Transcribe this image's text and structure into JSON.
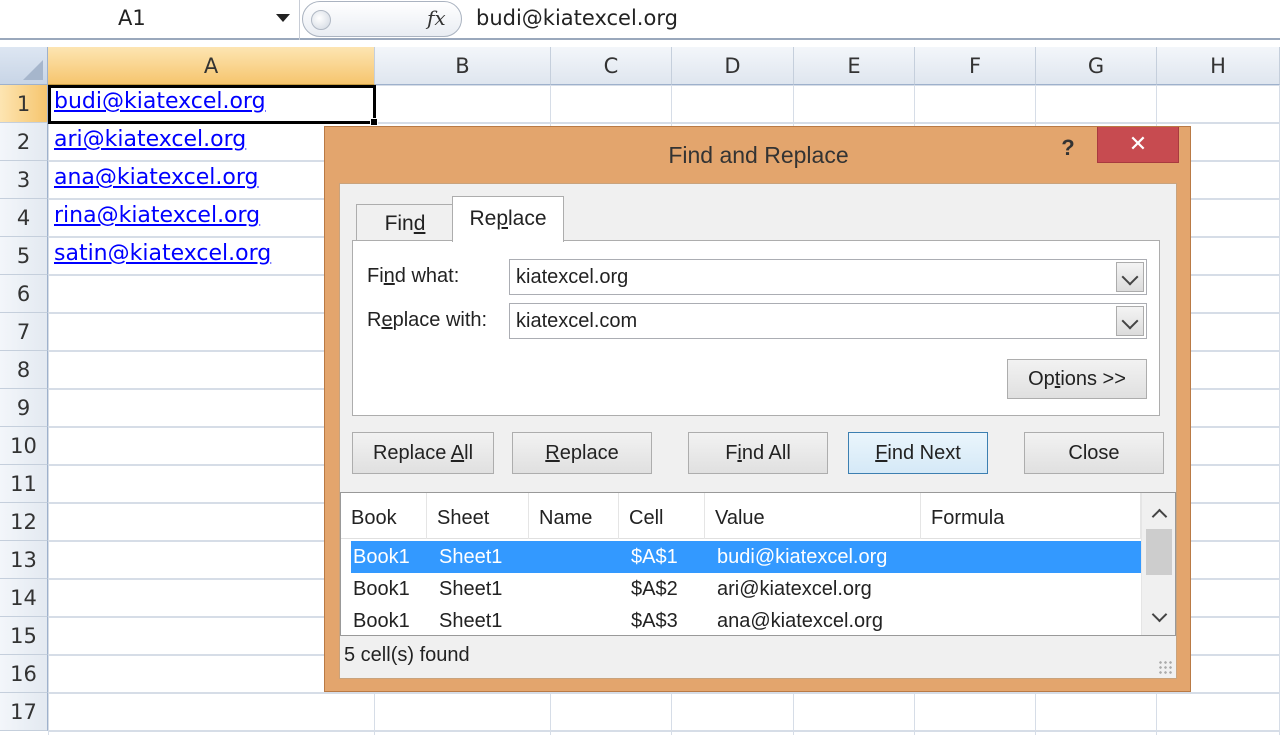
{
  "formula_bar": {
    "name_box": "A1",
    "fx_label": "fx",
    "formula": "budi@kiatexcel.org"
  },
  "grid": {
    "columns": [
      "A",
      "B",
      "C",
      "D",
      "E",
      "F",
      "G",
      "H"
    ],
    "selected_column": "A",
    "rows": [
      "1",
      "2",
      "3",
      "4",
      "5",
      "6",
      "7",
      "8",
      "9",
      "10",
      "11",
      "12",
      "13",
      "14",
      "15",
      "16",
      "17"
    ],
    "selected_row": "1",
    "cells_a": [
      "budi@kiatexcel.org",
      "ari@kiatexcel.org",
      "ana@kiatexcel.org",
      "rina@kiatexcel.org",
      "satin@kiatexcel.org"
    ]
  },
  "dialog": {
    "title": "Find and Replace",
    "help": "?",
    "close_x": "✕",
    "tabs": {
      "find": {
        "label": "Find"
      },
      "replace": {
        "label": "Replace"
      }
    },
    "find_what": {
      "label": "Find what:",
      "value": "kiatexcel.org"
    },
    "replace_with": {
      "label": "Replace with:",
      "value": "kiatexcel.com"
    },
    "options_button": "Options >>",
    "buttons": {
      "replace_all": "Replace All",
      "replace": "Replace",
      "find_all": "Find All",
      "find_next": "Find Next",
      "close": "Close"
    },
    "results": {
      "headers": [
        "Book",
        "Sheet",
        "Name",
        "Cell",
        "Value",
        "Formula"
      ],
      "rows": [
        {
          "book": "Book1",
          "sheet": "Sheet1",
          "name": "",
          "cell": "$A$1",
          "value": "budi@kiatexcel.org",
          "formula": ""
        },
        {
          "book": "Book1",
          "sheet": "Sheet1",
          "name": "",
          "cell": "$A$2",
          "value": "ari@kiatexcel.org",
          "formula": ""
        },
        {
          "book": "Book1",
          "sheet": "Sheet1",
          "name": "",
          "cell": "$A$3",
          "value": "ana@kiatexcel.org",
          "formula": ""
        }
      ],
      "selected_row": 0
    },
    "status": "5 cell(s) found"
  }
}
